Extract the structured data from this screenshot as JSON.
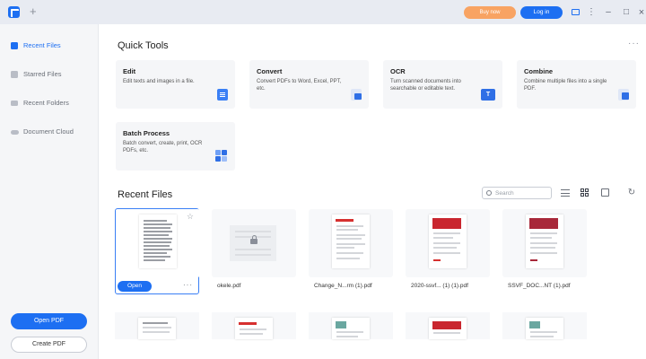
{
  "titlebar": {
    "new_tab": "+",
    "buy_now": "Buy now",
    "log_in": "Log in",
    "window_controls": [
      "more-icon",
      "minimize-icon",
      "maximize-icon",
      "close-icon"
    ]
  },
  "sidebar": {
    "items": [
      {
        "label": "Recent Files",
        "icon": "recent-files-icon",
        "active": true
      },
      {
        "label": "Starred Files",
        "icon": "star-icon",
        "active": false
      },
      {
        "label": "Recent Folders",
        "icon": "folder-icon",
        "active": false
      },
      {
        "label": "Document Cloud",
        "icon": "cloud-icon",
        "active": false
      }
    ],
    "open_pdf": "Open PDF",
    "create_pdf": "Create PDF"
  },
  "quick_tools": {
    "title": "Quick Tools",
    "tools": [
      {
        "title": "Edit",
        "desc": "Edit texts and images in a file."
      },
      {
        "title": "Convert",
        "desc": "Convert PDFs to Word, Excel, PPT, etc."
      },
      {
        "title": "OCR",
        "desc": "Turn scanned documents into searchable or editable text."
      },
      {
        "title": "Combine",
        "desc": "Combine multiple files into a single PDF."
      },
      {
        "title": "Batch Process",
        "desc": "Batch convert, create, print, OCR PDFs, etc."
      }
    ]
  },
  "recent": {
    "title": "Recent Files",
    "search_placeholder": "Search",
    "open_button": "Open",
    "files": [
      {
        "name": ""
      },
      {
        "name": "okele.pdf"
      },
      {
        "name": "Change_N...rm (1).pdf"
      },
      {
        "name": "2020-ssvf... (1) (1).pdf"
      },
      {
        "name": "SSVF_DOC...NT (1).pdf"
      }
    ]
  },
  "colors": {
    "accent": "#1d6ff2",
    "buy": "#f8a363"
  }
}
